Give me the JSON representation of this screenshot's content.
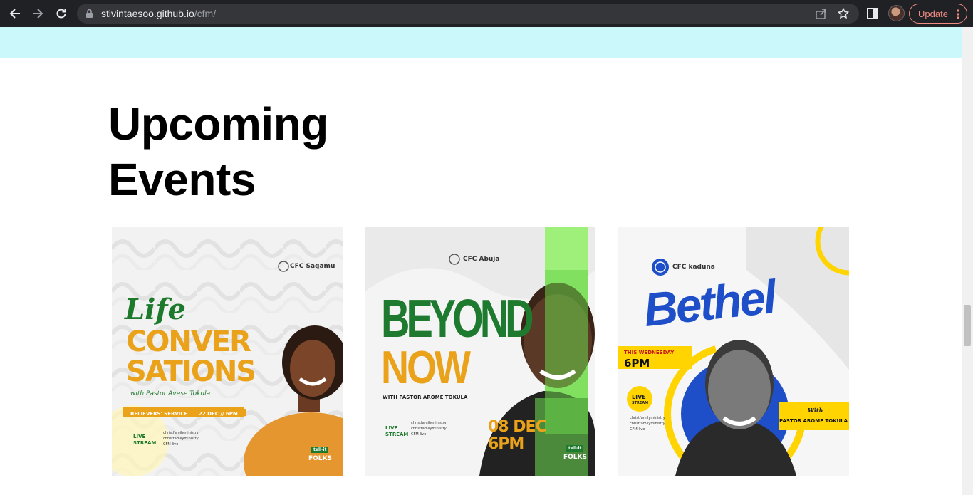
{
  "browser": {
    "url_host": "stivintaesoo.github.io",
    "url_path": "/cfm/",
    "update_label": "Update",
    "icons": [
      "back-arrow-icon",
      "forward-arrow-icon",
      "reload-icon",
      "lock-icon",
      "share-icon",
      "star-icon",
      "side-panel-icon",
      "kebab-menu-icon"
    ]
  },
  "page": {
    "heading_line1": "Upcoming",
    "heading_line2": "Events",
    "band_color": "#cbf8fb"
  },
  "events": [
    {
      "branch": "CFC Sagamu",
      "title_script": "Life",
      "title_line1": "CONVER",
      "title_line2": "SATIONS",
      "host": "with Pastor Avese Tokula",
      "service": "BELIEVERS' SERVICE",
      "date_time": "22 DEC // 6PM",
      "live": "LIVE",
      "stream": "STREAM",
      "socials": [
        "christfamilyministry",
        "christfamilyministry",
        "CFM-live"
      ],
      "tell_it": "tell-it",
      "brand": "FOLKS",
      "accent": "#e9a21a"
    },
    {
      "branch": "CFC Abuja",
      "title_line1": "BEYOND",
      "title_line2": "NOW",
      "host": "WITH PASTOR AROME TOKULA",
      "date": "08 DEC",
      "time": "6PM",
      "live": "LIVE",
      "stream": "STREAM",
      "socials": [
        "christfamilyministry",
        "christfamilyministry",
        "CFM-live"
      ],
      "tell_it": "tell-it",
      "brand": "FOLKS",
      "accent": "#1e7a2e"
    },
    {
      "branch": "CFC kaduna",
      "title": "Bethel",
      "day": "THIS WEDNESDAY",
      "time": "6PM",
      "live": "LIVE",
      "stream": "STREAM",
      "socials": [
        "christfamilyministry",
        "christfamilyministry",
        "CFM-live"
      ],
      "with": "With",
      "host": "PASTOR AROME TOKULA",
      "accent": "#1f4fc8"
    }
  ]
}
